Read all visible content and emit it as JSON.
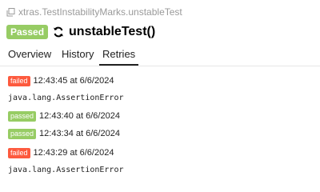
{
  "colors": {
    "passed": "#97cc64",
    "failed": "#fd5a3e"
  },
  "breadcrumb": {
    "icon": "copy-icon",
    "text": "xtras.TestInstabilityMarks.unstableTest"
  },
  "header": {
    "status": "Passed",
    "status_color": "#97cc64",
    "icon": "sync-icon",
    "test_name": "unstableTest()"
  },
  "tabs": [
    {
      "label": "Overview",
      "active": false
    },
    {
      "label": "History",
      "active": false
    },
    {
      "label": "Retries",
      "active": true
    }
  ],
  "retries": [
    {
      "status": "failed",
      "time": "12:43:45 at 6/6/2024",
      "error": "java.lang.AssertionError"
    },
    {
      "status": "passed",
      "time": "12:43:40 at 6/6/2024"
    },
    {
      "status": "passed",
      "time": "12:43:34 at 6/6/2024"
    },
    {
      "status": "failed",
      "time": "12:43:29 at 6/6/2024",
      "error": "java.lang.AssertionError"
    }
  ]
}
